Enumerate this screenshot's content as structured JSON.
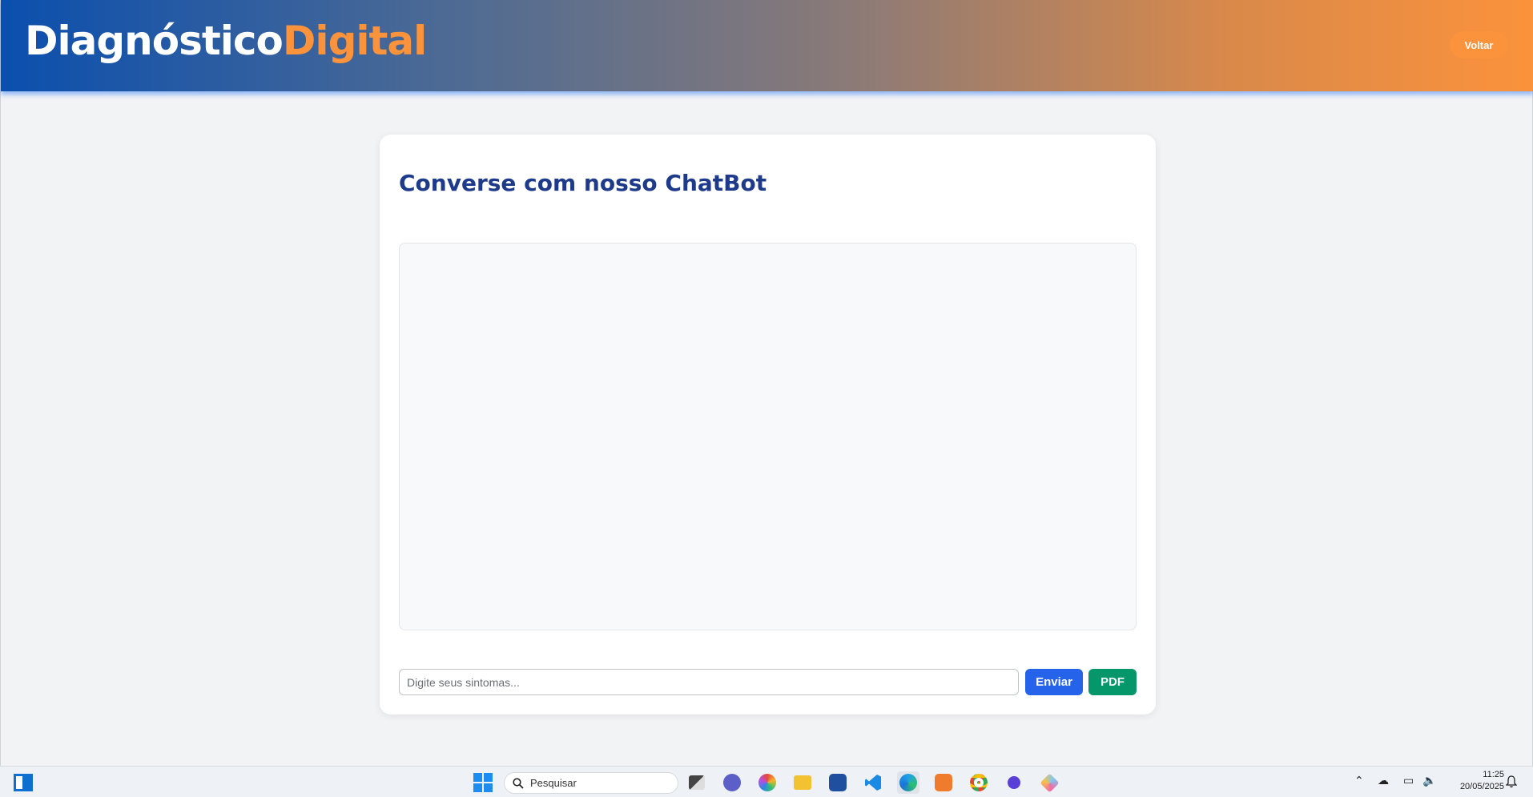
{
  "header": {
    "logo_part1": "Diagnóstico",
    "logo_part2": "Digital",
    "back_label": "Voltar"
  },
  "chat": {
    "title": "Converse com nosso ChatBot",
    "input_placeholder": "Digite seus sintomas...",
    "input_value": "",
    "send_label": "Enviar",
    "pdf_label": "PDF",
    "messages": []
  },
  "taskbar": {
    "search_placeholder": "Pesquisar",
    "apps": [
      "file-explorer-terminal-icon",
      "teams-icon",
      "microsoft-365-icon",
      "folder-icon",
      "store-icon",
      "vscode-icon",
      "edge-icon",
      "xampp-icon",
      "chrome-icon",
      "dot-app-icon",
      "git-icon"
    ],
    "time": "11:25",
    "date": "20/05/2025"
  },
  "colors": {
    "primary_blue": "#2563eb",
    "title_navy": "#1e3a8a",
    "accent_orange": "#fb923c",
    "pdf_green": "#059669"
  }
}
